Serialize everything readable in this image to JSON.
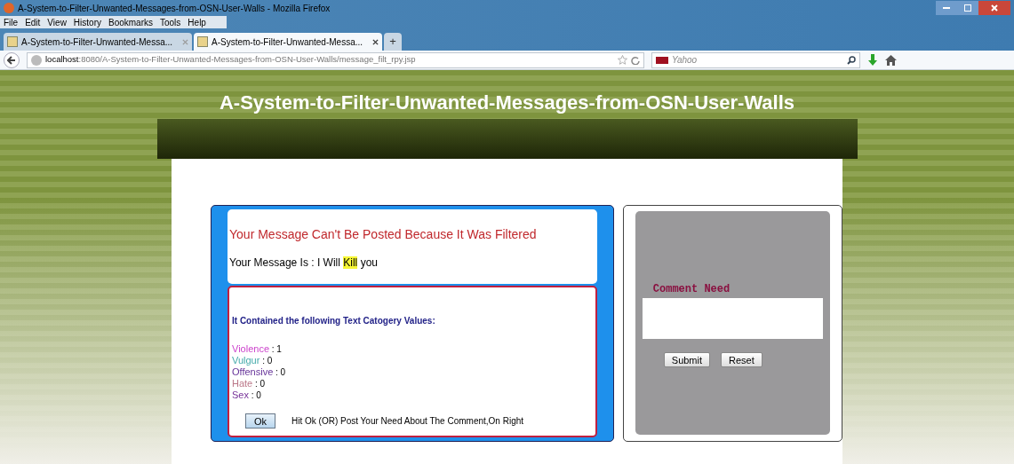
{
  "window": {
    "title": "A-System-to-Filter-Unwanted-Messages-from-OSN-User-Walls - Mozilla Firefox"
  },
  "menu": [
    "File",
    "Edit",
    "View",
    "History",
    "Bookmarks",
    "Tools",
    "Help"
  ],
  "tabs": [
    {
      "label": "A-System-to-Filter-Unwanted-Messa...",
      "selected": false
    },
    {
      "label": "A-System-to-Filter-Unwanted-Messa...",
      "selected": true
    }
  ],
  "new_tab": "+",
  "address": {
    "host": "localhost",
    "path": ":8080/A-System-to-Filter-Unwanted-Messages-from-OSN-User-Walls/message_filt_rpy.jsp"
  },
  "search": {
    "placeholder": "Yahoo"
  },
  "page": {
    "title": "A-System-to-Filter-Unwanted-Messages-from-OSN-User-Walls",
    "heading": "Your Message Can't Be Posted Because It Was Filtered",
    "message": {
      "prefix": "Your Message Is : I Will",
      "highlight": "Kill",
      "suffix": "you"
    },
    "categories_title": "It Contained the following Text Catogery Values:",
    "categories": [
      {
        "name": "Violence",
        "value": ": 1",
        "color": "#cc44cc"
      },
      {
        "name": "Vulgur",
        "value": ": 0",
        "color": "#44aaaa"
      },
      {
        "name": "Offensive",
        "value": ": 0",
        "color": "#663399"
      },
      {
        "name": "Hate",
        "value": ": 0",
        "color": "#bb7788"
      },
      {
        "name": "Sex",
        "value": ": 0",
        "color": "#773399"
      }
    ],
    "ok_button": "Ok",
    "hint": "Hit Ok (OR) Post Your Need About The Comment,On Right",
    "comment_label": "Comment Need",
    "buttons": [
      "Submit",
      "Reset"
    ]
  }
}
